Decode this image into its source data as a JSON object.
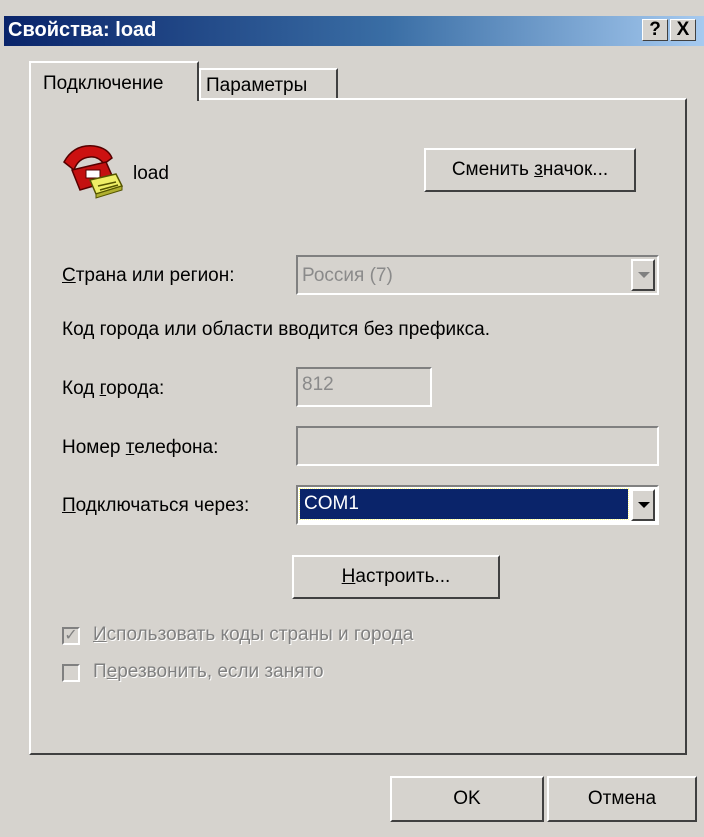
{
  "window": {
    "title": "Свойства: load",
    "help_label": "?",
    "close_label": "X"
  },
  "tabs": [
    {
      "label": "Подключение",
      "selected": true
    },
    {
      "label": "Параметры",
      "selected": false
    }
  ],
  "connection": {
    "name": "load",
    "icon": "telephone-icon",
    "change_icon_button": {
      "before": "Сменить ",
      "key": "з",
      "after": "начок..."
    }
  },
  "country": {
    "label_key": "С",
    "label_rest": "трана или регион:",
    "value": "Россия (7)"
  },
  "hint": "Код города или области вводится без префикса.",
  "city_code": {
    "label_before": "Код ",
    "label_key": "г",
    "label_after": "орода:",
    "value": "812"
  },
  "phone": {
    "label_before": "Номер ",
    "label_key": "т",
    "label_after": "елефона:",
    "value": ""
  },
  "connect_using": {
    "label_key": "П",
    "label_rest": "одключаться через:",
    "value": "COM1"
  },
  "configure_button": {
    "key": "Н",
    "rest": "астроить..."
  },
  "use_codes": {
    "key": "И",
    "rest": "спользовать коды страны и города",
    "checked": true,
    "checkmark": "✓"
  },
  "redial": {
    "before": "П",
    "key": "е",
    "after": "резвонить, если занято",
    "checked": false
  },
  "footer": {
    "ok": "OK",
    "cancel": "Отмена"
  }
}
